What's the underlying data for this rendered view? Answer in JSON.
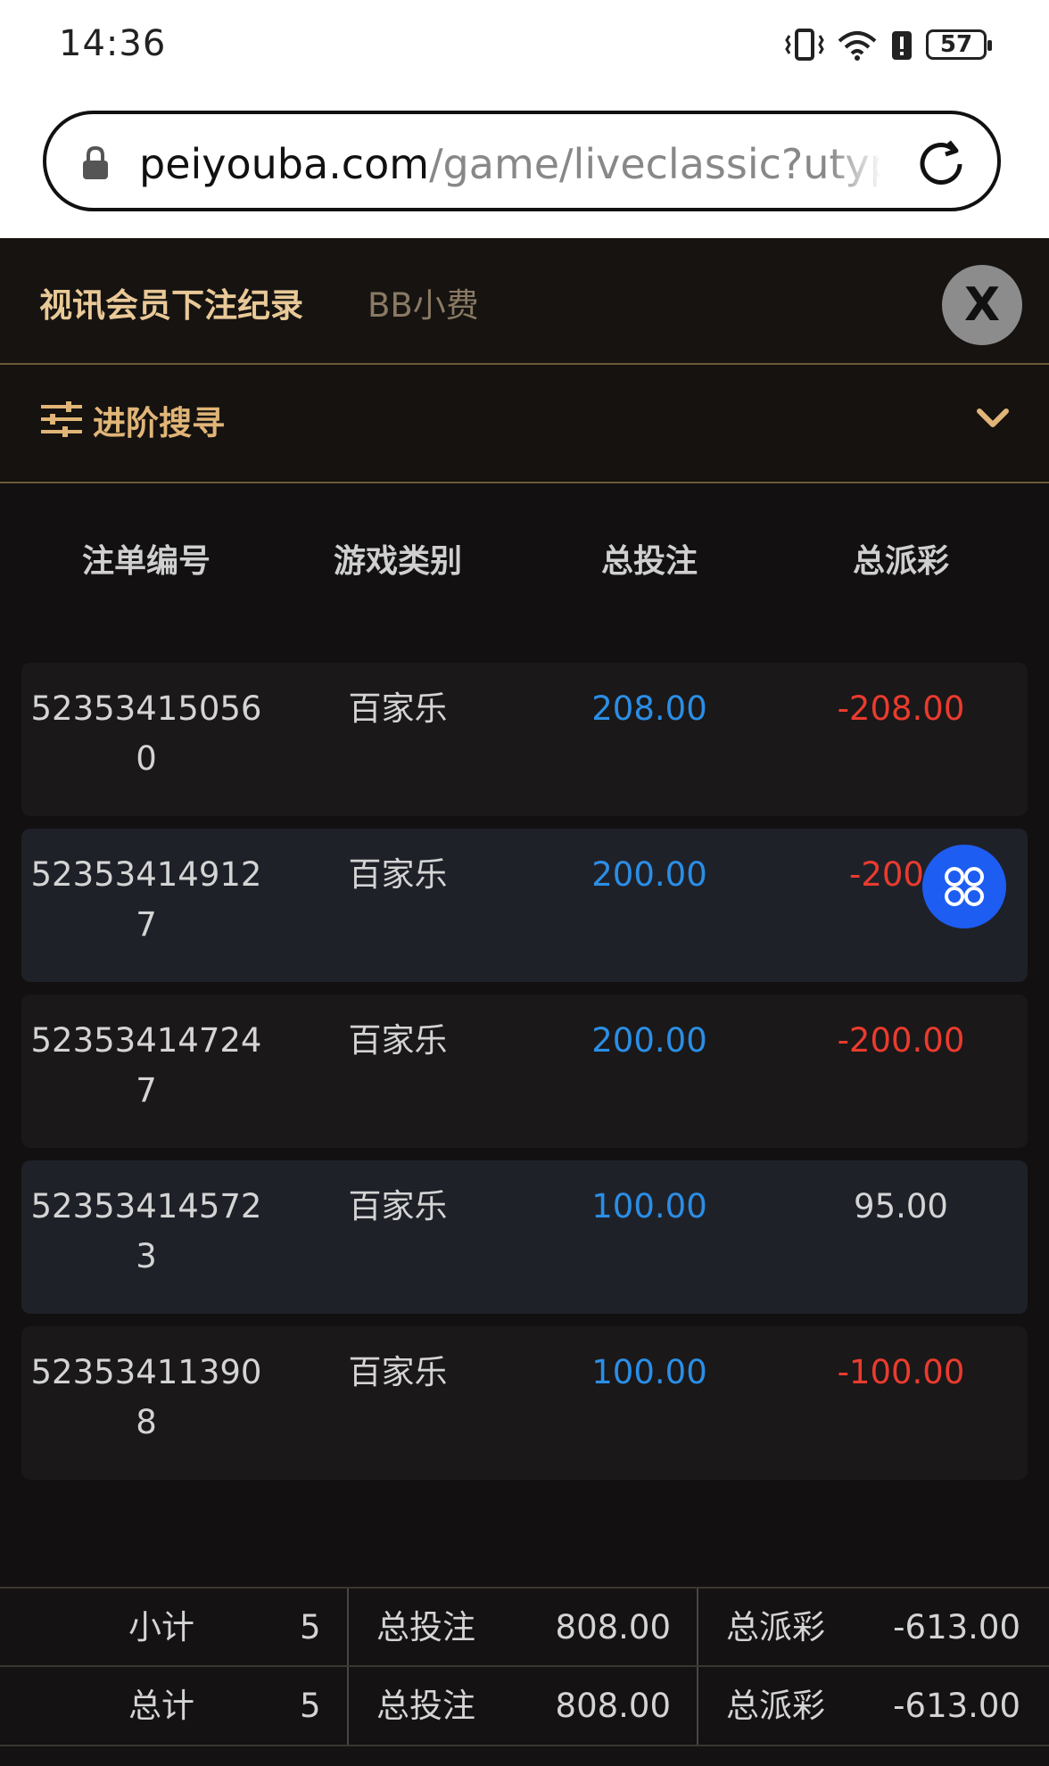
{
  "status_bar": {
    "time": "14:36",
    "battery": "57"
  },
  "browser": {
    "url_host": "peiyouba.com",
    "url_path": "/game/liveclassic?utype="
  },
  "header": {
    "tab_active": "视讯会员下注纪录",
    "tab_other": "BB小费",
    "close_label": "X"
  },
  "advanced_search": {
    "label": "进阶搜寻"
  },
  "table": {
    "columns": [
      "注单编号",
      "游戏类别",
      "总投注",
      "总派彩"
    ],
    "rows": [
      {
        "id_line1": "52353415056",
        "id_line2": "0",
        "game": "百家乐",
        "bet": "208.00",
        "payout": "-208.00"
      },
      {
        "id_line1": "52353414912",
        "id_line2": "7",
        "game": "百家乐",
        "bet": "200.00",
        "payout": "-200."
      },
      {
        "id_line1": "52353414724",
        "id_line2": "7",
        "game": "百家乐",
        "bet": "200.00",
        "payout": "-200.00"
      },
      {
        "id_line1": "52353414572",
        "id_line2": "3",
        "game": "百家乐",
        "bet": "100.00",
        "payout": "95.00"
      },
      {
        "id_line1": "52353411390",
        "id_line2": "8",
        "game": "百家乐",
        "bet": "100.00",
        "payout": "-100.00"
      }
    ]
  },
  "summary": {
    "subtotal": {
      "label": "小计",
      "count": "5",
      "bet_label": "总投注",
      "bet": "808.00",
      "pay_label": "总派彩",
      "pay": "-613.00"
    },
    "total": {
      "label": "总计",
      "count": "5",
      "bet_label": "总投注",
      "bet": "808.00",
      "pay_label": "总派彩",
      "pay": "-613.00"
    }
  },
  "colors": {
    "accent_gold": "#e0b577",
    "bet_blue": "#2b8ee6",
    "negative_red": "#ea3b2f",
    "fab_blue": "#1d5df2"
  }
}
